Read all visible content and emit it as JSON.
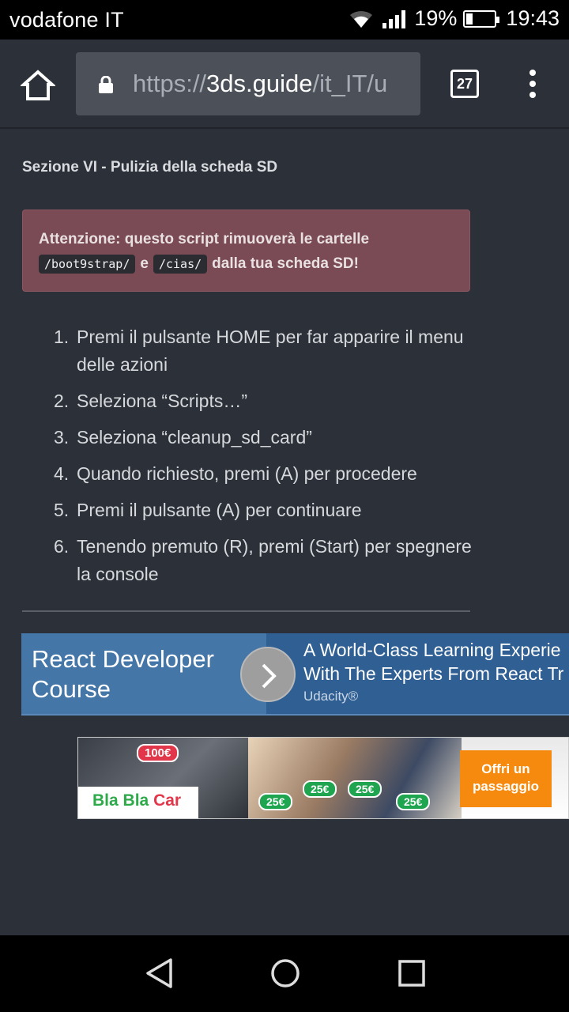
{
  "status_bar": {
    "carrier": "vodafone IT",
    "battery_text": "19%",
    "battery_level": 0.19,
    "time": "19:43"
  },
  "browser": {
    "url_scheme": "https://",
    "url_host": "3ds.guide",
    "url_path": "/it_IT/u",
    "tab_count": "27"
  },
  "page": {
    "section_title": "Sezione VI - Pulizia della scheda SD",
    "alert": {
      "line1": "Attenzione: questo script rimuoverà le cartelle",
      "code1": "/boot9strap/",
      "conj": "e",
      "code2": "/cias/",
      "line2_end": "dalla tua scheda SD!"
    },
    "steps": [
      {
        "num": "1.",
        "text": "Premi il pulsante HOME per far apparire il menu delle azioni"
      },
      {
        "num": "2.",
        "text": "Seleziona “Scripts…”"
      },
      {
        "num": "3.",
        "text": "Seleziona “cleanup_sd_card”"
      },
      {
        "num": "4.",
        "text": "Quando richiesto, premi (A) per procedere"
      },
      {
        "num": "5.",
        "text": "Premi il pulsante (A) per continuare"
      },
      {
        "num": "6.",
        "text": "Tenendo premuto (R), premi (Start) per spegnere la console"
      }
    ]
  },
  "ad1": {
    "title": "React Developer Course",
    "headline_line1": "A World-Class Learning Experie",
    "headline_line2": "With The Experts From React Tr",
    "brand": "Udacity®"
  },
  "ad2": {
    "logo_bla1": "Bla",
    "logo_bla2": "Bla",
    "logo_car": "Car",
    "price_big": "100€",
    "price_small": "25€",
    "cta": "Offri un passaggio"
  },
  "colors": {
    "page_bg": "#2b3039",
    "alert_bg": "#7b4b55",
    "ad_blue": "#4476a8",
    "blablacar_green": "#2eaa4a",
    "cta_orange": "#f58a0f"
  }
}
